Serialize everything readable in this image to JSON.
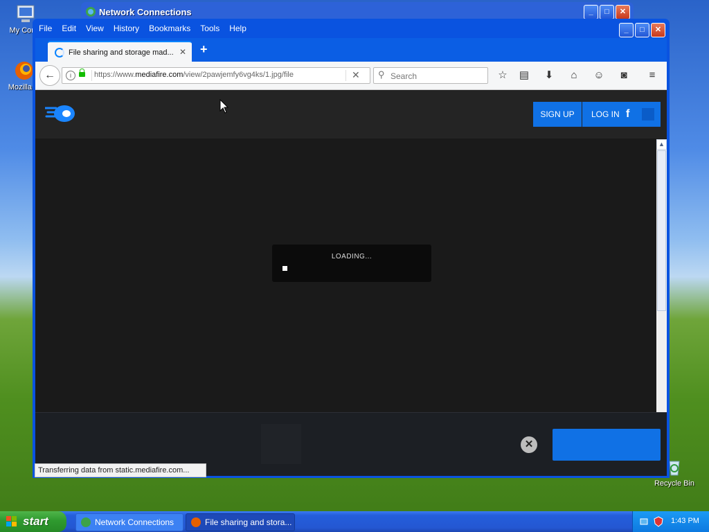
{
  "desktop": {
    "icons": [
      {
        "label": "My Comp"
      },
      {
        "label": "Mozilla Fi"
      },
      {
        "label": "Recycle Bin"
      }
    ]
  },
  "background_window": {
    "title": "Network Connections"
  },
  "browser": {
    "menu": [
      "File",
      "Edit",
      "View",
      "History",
      "Bookmarks",
      "Tools",
      "Help"
    ],
    "tab": {
      "title": "File sharing and storage mad..."
    },
    "url": {
      "prefix": "https://www.",
      "domain": "mediafire.com",
      "path": "/view/2pawjemfy6vg4ks/1.jpg/file"
    },
    "search": {
      "placeholder": "Search"
    },
    "toolbar_icons": [
      "star-icon",
      "reading-list-icon",
      "download-icon",
      "home-icon",
      "emoji-icon",
      "pocket-icon",
      "hamburger-menu-icon"
    ],
    "status_text": "Transferring data from static.mediafire.com..."
  },
  "site": {
    "signup_label": "SIGN UP",
    "login_label": "LOG IN",
    "facebook_glyph": "f",
    "loading_text": "LOADING..."
  },
  "taskbar": {
    "start_label": "start",
    "tasks": [
      {
        "label": "Network Connections"
      },
      {
        "label": "File sharing and stora..."
      }
    ],
    "clock": "1:43 PM"
  },
  "colors": {
    "accent": "#1071e5",
    "xp_blue": "#0a53e0",
    "content_bg": "#1a1a1a"
  }
}
